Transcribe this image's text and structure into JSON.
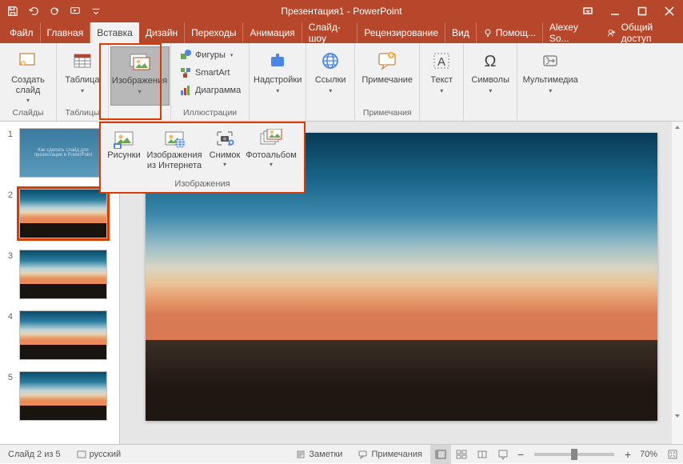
{
  "title": "Презентация1 - PowerPoint",
  "user": "Alexey So...",
  "share": "Общий доступ",
  "tabs": {
    "file": "Файл",
    "home": "Главная",
    "insert": "Вставка",
    "design": "Дизайн",
    "transitions": "Переходы",
    "animations": "Анимация",
    "slideshow": "Слайд-шоу",
    "review": "Рецензирование",
    "view": "Вид",
    "help": "Помощ..."
  },
  "ribbon": {
    "slides_group": "Слайды",
    "new_slide": "Создать слайд",
    "tables_group": "Таблицы",
    "table": "Таблица",
    "images_group": "Изображения",
    "images": "Изображения",
    "illustrations_group": "Иллюстрации",
    "shapes": "Фигуры",
    "smartart": "SmartArt",
    "chart": "Диаграмма",
    "addins": "Надстройки",
    "links": "Ссылки",
    "comments_group": "Примечания",
    "comment": "Примечание",
    "text": "Текст",
    "symbols": "Символы",
    "media": "Мультимедиа"
  },
  "popup": {
    "group": "Изображения",
    "pictures": "Рисунки",
    "online": "Изображения из Интернета",
    "screenshot": "Снимок",
    "album": "Фотоальбом"
  },
  "slide1": {
    "line1": "Как сделать слайд для",
    "line2": "презентации в PowerPoint"
  },
  "thumbs": [
    "1",
    "2",
    "3",
    "4",
    "5"
  ],
  "status": {
    "slide_of": "Слайд 2 из 5",
    "lang": "русский",
    "notes": "Заметки",
    "comments": "Примечания",
    "zoom": "70%"
  }
}
